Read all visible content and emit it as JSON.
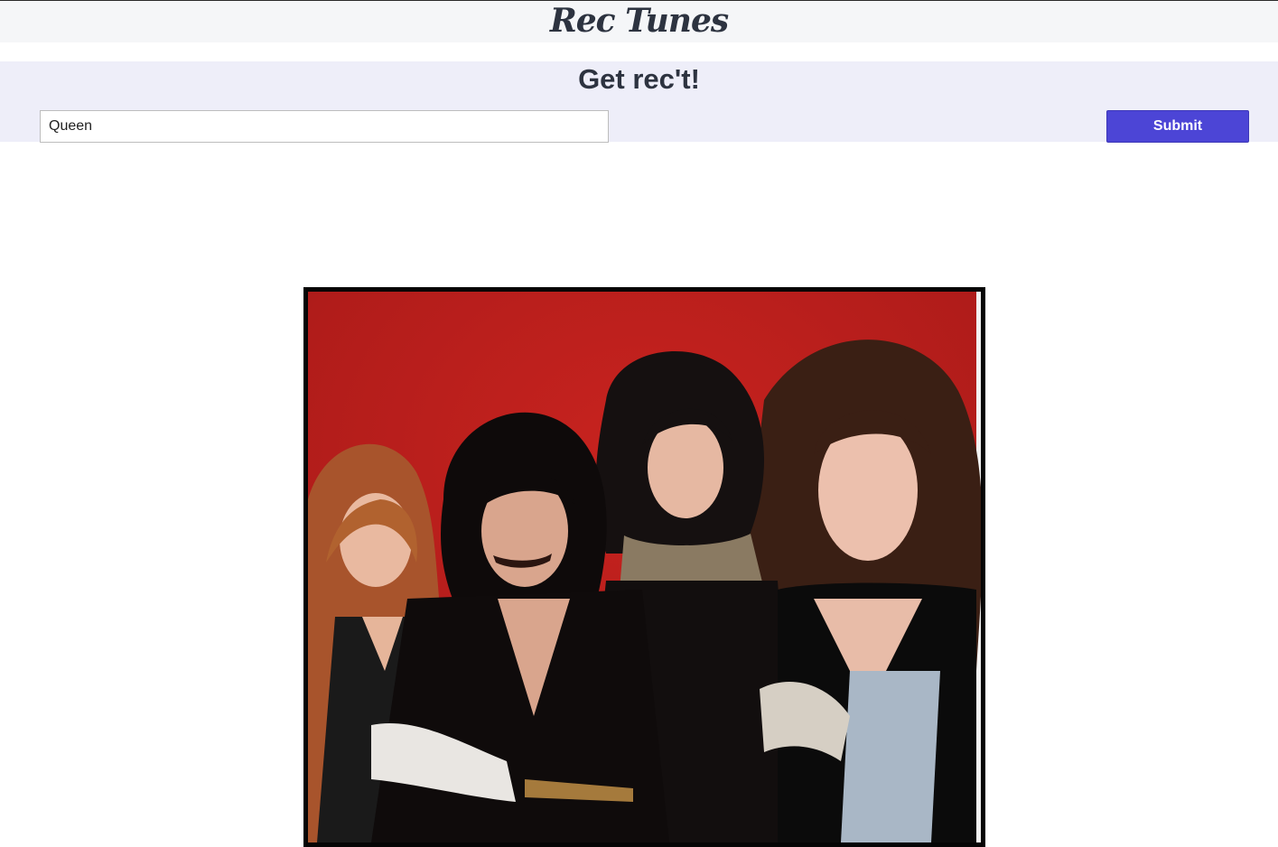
{
  "header": {
    "logo_text": "Rec Tunes"
  },
  "hero": {
    "title": "Get rec't!"
  },
  "search": {
    "value": "Queen",
    "placeholder": ""
  },
  "actions": {
    "submit_label": "Submit"
  },
  "colors": {
    "accent": "#4c45d6",
    "hero_bg": "#eeeef9",
    "topbar_bg": "#f5f6f8",
    "text": "#2d3340",
    "photo_background": "#b81f1c"
  },
  "artist_image": {
    "alt": "Queen"
  }
}
